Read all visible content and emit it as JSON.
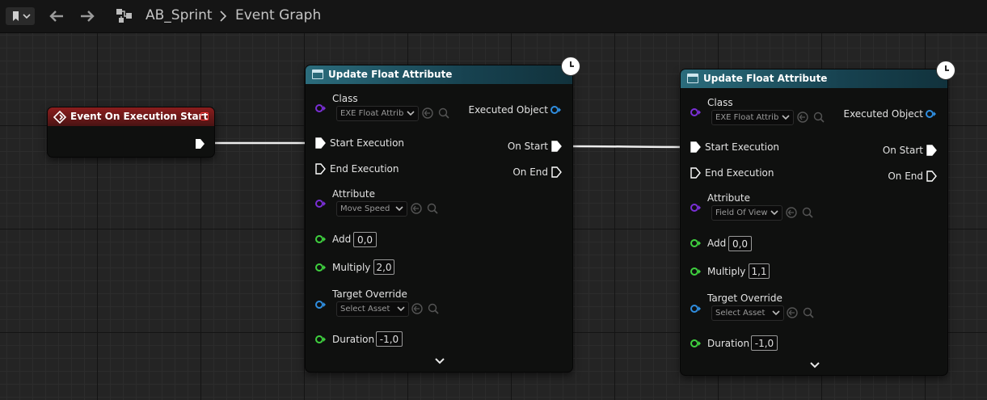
{
  "breadcrumb": {
    "asset": "AB_Sprint",
    "graph": "Event Graph"
  },
  "event_node": {
    "title": "Event On Execution Start"
  },
  "nodes": [
    {
      "title": "Update Float Attribute",
      "class_label": "Class",
      "class_value": "EXE Float Attrib",
      "executed_object": "Executed Object",
      "start_execution": "Start Execution",
      "end_execution": "End Execution",
      "on_start": "On Start",
      "on_end": "On End",
      "attribute_label": "Attribute",
      "attribute_value": "Move Speed",
      "add_label": "Add",
      "add_value": "0,0",
      "multiply_label": "Multiply",
      "multiply_value": "2,0",
      "target_label": "Target Override",
      "target_value": "Select Asset",
      "duration_label": "Duration",
      "duration_value": "-1,0"
    },
    {
      "title": "Update Float Attribute",
      "class_label": "Class",
      "class_value": "EXE Float Attrib",
      "executed_object": "Executed Object",
      "start_execution": "Start Execution",
      "end_execution": "End Execution",
      "on_start": "On Start",
      "on_end": "On End",
      "attribute_label": "Attribute",
      "attribute_value": "Field Of View",
      "add_label": "Add",
      "add_value": "0,0",
      "multiply_label": "Multiply",
      "multiply_value": "1,1",
      "target_label": "Target Override",
      "target_value": "Select Asset",
      "duration_label": "Duration",
      "duration_value": "-1,0"
    }
  ],
  "colors": {
    "object_pin": "#7a2fd6",
    "float_pin": "#3fd13f",
    "asset_pin": "#2f8ee0",
    "exec_pin": "#ffffff",
    "event_header": "#8b1d1d",
    "function_header": "#2b6c7c"
  }
}
